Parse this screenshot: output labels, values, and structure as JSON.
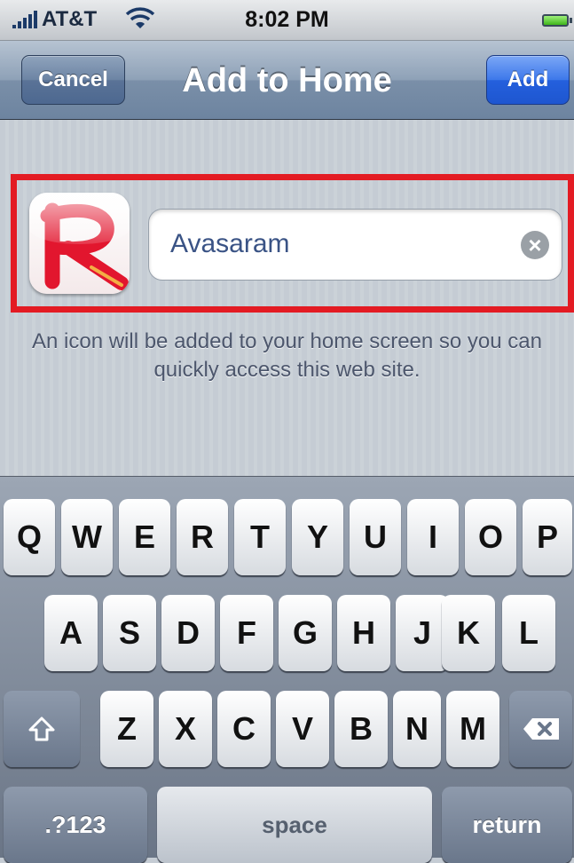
{
  "status": {
    "carrier": "AT&T",
    "time": "8:02 PM"
  },
  "nav": {
    "title": "Add to Home",
    "cancel_label": "Cancel",
    "add_label": "Add"
  },
  "form": {
    "name_value": "Avasaram",
    "hint": "An icon will be added to your home screen so you can quickly access this web site."
  },
  "icons": {
    "signal": "signal-bars-icon",
    "wifi": "wifi-icon",
    "battery": "battery-icon",
    "app": "avasaram-app-icon",
    "clear": "clear-text-icon",
    "shift": "shift-icon",
    "delete": "backspace-icon"
  },
  "colors": {
    "highlight": "#e31b23",
    "add_button": "#2460dd",
    "field_text": "#3a5385"
  },
  "keyboard": {
    "row1": [
      "Q",
      "W",
      "E",
      "R",
      "T",
      "Y",
      "U",
      "I",
      "O",
      "P"
    ],
    "row2": [
      "A",
      "S",
      "D",
      "F",
      "G",
      "H",
      "J",
      "K",
      "L"
    ],
    "row3": [
      "Z",
      "X",
      "C",
      "V",
      "B",
      "N",
      "M"
    ],
    "numbers_label": ".?123",
    "space_label": "space",
    "return_label": "return"
  }
}
